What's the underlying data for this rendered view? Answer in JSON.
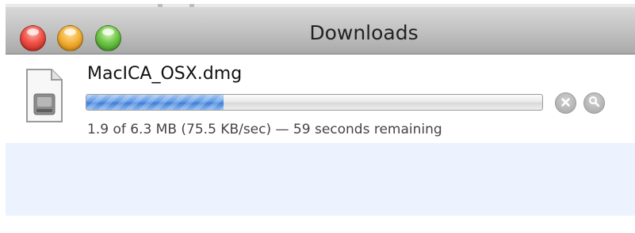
{
  "window": {
    "title": "Downloads"
  },
  "download": {
    "file_name": "MacICA_OSX.dmg",
    "file_type_icon": "disk-image-icon",
    "progress_fraction": 0.3,
    "status": "1.9 of 6.3 MB (75.5 KB/sec) — 59 seconds remaining",
    "stop_icon": "stop-x-icon",
    "reveal_icon": "magnifier-icon"
  },
  "colors": {
    "progress_blue": "#4f8de0",
    "alternate_row": "#edf3fe",
    "titlebar": "#c0c0c0"
  }
}
